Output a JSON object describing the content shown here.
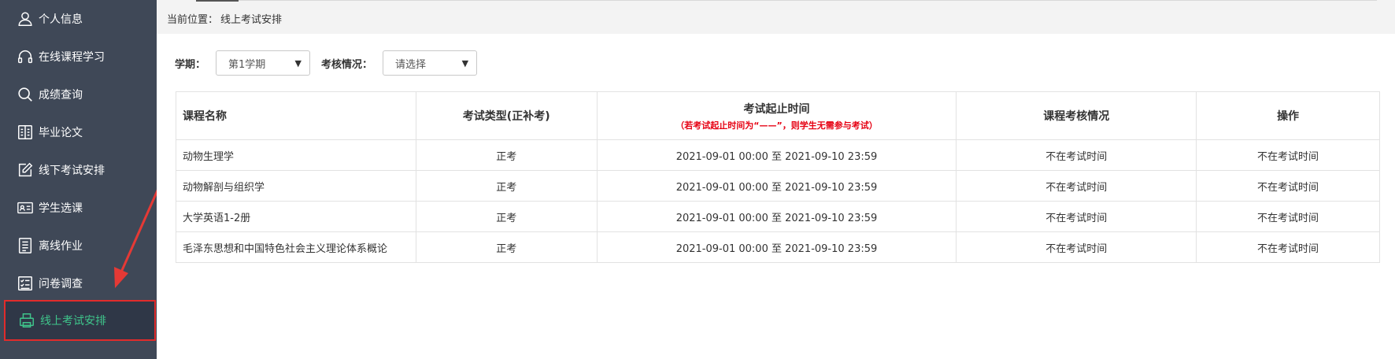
{
  "sidebar": {
    "items": [
      {
        "label": "个人信息",
        "icon": "user-icon"
      },
      {
        "label": "在线课程学习",
        "icon": "headphones-icon"
      },
      {
        "label": "成绩查询",
        "icon": "search-icon"
      },
      {
        "label": "毕业论文",
        "icon": "book-icon"
      },
      {
        "label": "线下考试安排",
        "icon": "edit-icon"
      },
      {
        "label": "学生选课",
        "icon": "id-card-icon"
      },
      {
        "label": "离线作业",
        "icon": "document-icon"
      },
      {
        "label": "问卷调查",
        "icon": "checklist-icon"
      },
      {
        "label": "线上考试安排",
        "icon": "printer-icon"
      }
    ],
    "active_index": 8
  },
  "breadcrumb": {
    "prefix": "当前位置：",
    "current": "线上考试安排"
  },
  "filters": {
    "term_label": "学期：",
    "term_value": "第1学期",
    "status_label": "考核情况：",
    "status_value": "请选择"
  },
  "table": {
    "headers": {
      "course": "课程名称",
      "type": "考试类型(正补考)",
      "time": "考试起止时间",
      "time_note": "（若考试起止时间为“——”，则学生无需参与考试）",
      "status": "课程考核情况",
      "action": "操作"
    },
    "rows": [
      {
        "course": "动物生理学",
        "type": "正考",
        "time": "2021-09-01 00:00 至 2021-09-10 23:59",
        "status": "不在考试时间",
        "action": "不在考试时间"
      },
      {
        "course": "动物解剖与组织学",
        "type": "正考",
        "time": "2021-09-01 00:00 至 2021-09-10 23:59",
        "status": "不在考试时间",
        "action": "不在考试时间"
      },
      {
        "course": "大学英语1-2册",
        "type": "正考",
        "time": "2021-09-01 00:00 至 2021-09-10 23:59",
        "status": "不在考试时间",
        "action": "不在考试时间"
      },
      {
        "course": "毛泽东思想和中国特色社会主义理论体系概论",
        "type": "正考",
        "time": "2021-09-01 00:00 至 2021-09-10 23:59",
        "status": "不在考试时间",
        "action": "不在考试时间"
      }
    ]
  },
  "colors": {
    "sidebar_bg": "#3f4857",
    "active_text": "#3fc48b",
    "highlight_border": "#e12b2b",
    "note_red": "#e60012",
    "type_green": "#4caf50",
    "status_blue": "#1f4ea8"
  }
}
